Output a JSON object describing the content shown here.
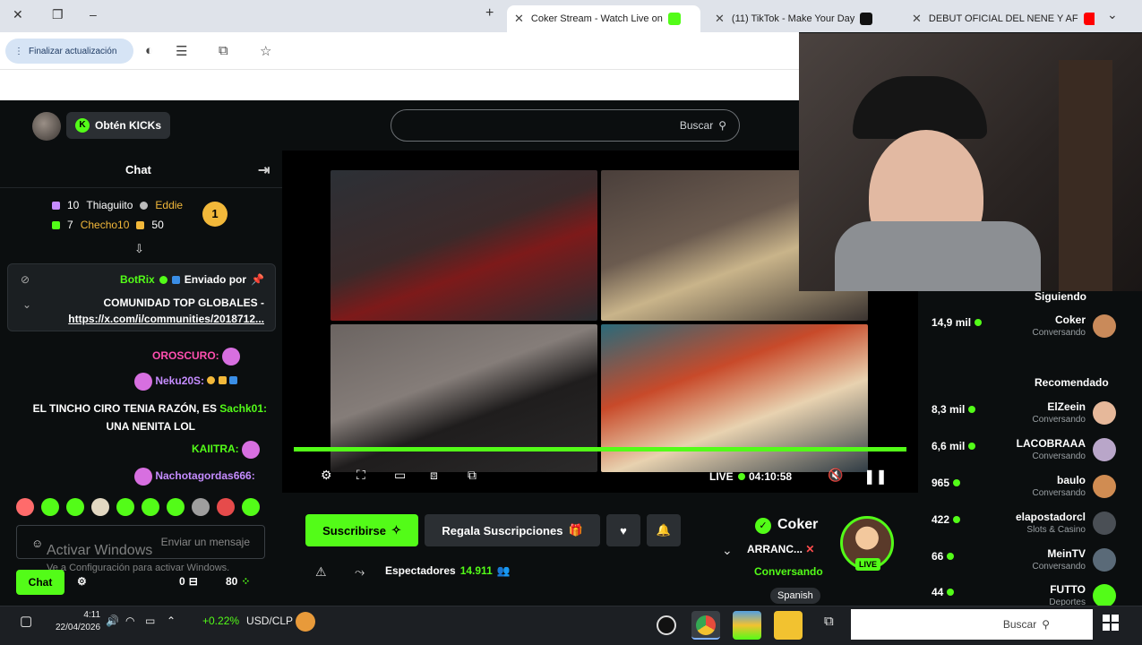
{
  "browser": {
    "tabs": [
      {
        "title": "DEBUT OFICIAL DEL NENE Y AF",
        "color": "#ff0000"
      },
      {
        "title": "(11) TikTok - Make Your Day",
        "color": "#111111"
      },
      {
        "title": "Coker Stream - Watch Live on",
        "color": "#53fc18"
      }
    ],
    "new_tab": "+",
    "update_label": "Finalizar actualización"
  },
  "header": {
    "kicks_label": "Obtén KICKs",
    "search_placeholder": "Buscar"
  },
  "chat": {
    "title": "Chat",
    "leaderboard": [
      {
        "name": "Thiaguiito",
        "count": "10",
        "color": "#c58cff"
      },
      {
        "name": "Eddie",
        "count": "",
        "color": "#f2b83a"
      },
      {
        "name": "Checho10",
        "count": "7",
        "color": "#53fc18"
      },
      {
        "name": "",
        "count": "50",
        "color": "#f2b83a"
      }
    ],
    "rank": "1",
    "pinned": {
      "sent_by_label": "Enviado por",
      "bot_name": "BotRix",
      "line1": "COMUNIDAD TOP GLOBALES -",
      "line2": "https://x.com/i/communities/2018712..."
    },
    "messages": [
      {
        "user": "OROSCURO:",
        "text": "",
        "color": "#ff4fb0"
      },
      {
        "user": "Neku20S:",
        "text": "",
        "color": "#c58cff"
      },
      {
        "user": "Sachk01:",
        "text": "EL TINCHO CIRO TENIA RAZÓN, ES",
        "color": "#53fc18"
      },
      {
        "user": "",
        "text": "UNA NENITA LOL",
        "color": "#ffffff"
      },
      {
        "user": "KAIITRA:",
        "text": "",
        "color": "#53fc18"
      },
      {
        "user": "Nachotagordas666:",
        "text": "",
        "color": "#c58cff"
      }
    ],
    "input_placeholder": "Enviar un mensaje",
    "send_label": "Chat",
    "points": "80",
    "zero": "0"
  },
  "windows_watermark": {
    "line1": "Activar Windows",
    "line2": "Ve a Configuración para activar Windows."
  },
  "player": {
    "elapsed": "04:10:58",
    "live_label": "LIVE",
    "progress_fraction": 1.0
  },
  "stream": {
    "streamer": "Coker",
    "title": "ARRANC...",
    "category": "Conversando",
    "language": "Spanish",
    "viewers": "14.911",
    "viewers_label": "Espectadores",
    "subscribe_label": "Suscribirse",
    "gift_label": "Regala Suscripciones",
    "live_tag": "LIVE"
  },
  "sidebar": {
    "following_label": "Siguiendo",
    "recommended_label": "Recomendado",
    "following": [
      {
        "name": "Coker",
        "category": "Conversando",
        "viewers": "14,9 mil",
        "color": "#c98a5a"
      }
    ],
    "recommended": [
      {
        "name": "ElZeein",
        "category": "Conversando",
        "viewers": "8,3 mil",
        "color": "#e6b89a"
      },
      {
        "name": "LACOBRAAA",
        "category": "Conversando",
        "viewers": "6,6 mil",
        "color": "#b9a6c9"
      },
      {
        "name": "baulo",
        "category": "Conversando",
        "viewers": "965",
        "color": "#d08c52"
      },
      {
        "name": "elapostadorcl",
        "category": "Slots & Casino",
        "viewers": "422",
        "color": "#4a4f55"
      },
      {
        "name": "MeinTV",
        "category": "Conversando",
        "viewers": "66",
        "color": "#5a6a78"
      },
      {
        "name": "FUTTO",
        "category": "Deportes",
        "viewers": "44",
        "color": "#53fc18"
      }
    ]
  },
  "taskbar": {
    "search_placeholder": "Buscar",
    "ticker": "USD/CLP",
    "ticker_change": "+0.22%",
    "time": "4:11",
    "date": "22/04/2026"
  },
  "colors": {
    "accent": "#53fc18",
    "background": "#0b0e0f"
  }
}
